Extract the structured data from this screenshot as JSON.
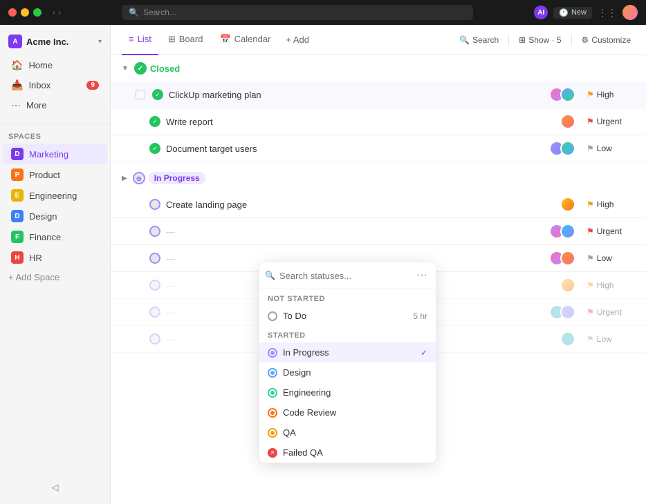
{
  "titlebar": {
    "search_placeholder": "Search...",
    "ai_label": "AI",
    "new_label": "New"
  },
  "workspace": {
    "name": "Acme Inc.",
    "icon_label": "A"
  },
  "sidebar": {
    "nav_items": [
      {
        "id": "home",
        "label": "Home",
        "icon": "🏠"
      },
      {
        "id": "inbox",
        "label": "Inbox",
        "icon": "📥",
        "badge": "9"
      },
      {
        "id": "more",
        "label": "More",
        "icon": "⋯"
      }
    ],
    "spaces_label": "Spaces",
    "spaces": [
      {
        "id": "marketing",
        "label": "Marketing",
        "color": "purple",
        "letter": "D",
        "active": true
      },
      {
        "id": "product",
        "label": "Product",
        "color": "orange",
        "letter": "P"
      },
      {
        "id": "engineering",
        "label": "Engineering",
        "color": "yellow",
        "letter": "E"
      },
      {
        "id": "design",
        "label": "Design",
        "color": "blue",
        "letter": "D"
      },
      {
        "id": "finance",
        "label": "Finance",
        "color": "green",
        "letter": "F"
      },
      {
        "id": "hr",
        "label": "HR",
        "color": "red",
        "letter": "H"
      }
    ],
    "add_space_label": "+ Add Space"
  },
  "tabs": [
    {
      "id": "list",
      "label": "List",
      "active": true
    },
    {
      "id": "board",
      "label": "Board"
    },
    {
      "id": "calendar",
      "label": "Calendar"
    },
    {
      "id": "add",
      "label": "+ Add"
    }
  ],
  "header_actions": {
    "search": "Search",
    "show": "Show · 5",
    "customize": "Customize"
  },
  "sections": {
    "closed": {
      "label": "Closed",
      "tasks": [
        {
          "name": "ClickUp marketing plan",
          "priority": "High",
          "priority_class": "high",
          "avatars": 2
        },
        {
          "name": "Write report",
          "priority": "Urgent",
          "priority_class": "urgent",
          "avatars": 1
        },
        {
          "name": "Document target users",
          "priority": "Low",
          "priority_class": "low",
          "avatars": 2
        }
      ]
    },
    "in_progress": {
      "label": "In Progress",
      "tasks": [
        {
          "name": "Create landing page",
          "priority": "High",
          "priority_class": "high",
          "avatars": 1
        },
        {
          "name": "",
          "priority": "Urgent",
          "priority_class": "urgent",
          "avatars": 2
        },
        {
          "name": "",
          "priority": "Low",
          "priority_class": "low",
          "avatars": 2
        },
        {
          "name": "",
          "priority": "High",
          "priority_class": "high",
          "avatars": 1
        },
        {
          "name": "",
          "priority": "Urgent",
          "priority_class": "urgent",
          "avatars": 2
        },
        {
          "name": "",
          "priority": "Low",
          "priority_class": "low",
          "avatars": 1
        }
      ]
    }
  },
  "dropdown": {
    "search_placeholder": "Search statuses...",
    "not_started_label": "NOT STARTED",
    "started_label": "STARTED",
    "items_not_started": [
      {
        "id": "todo",
        "label": "To Do",
        "time": "5 hr",
        "dot_class": "todo-dot"
      }
    ],
    "items_started": [
      {
        "id": "inprogress",
        "label": "In Progress",
        "dot_class": "inprogress-dot",
        "selected": true
      },
      {
        "id": "design",
        "label": "Design",
        "dot_class": "design-dot"
      },
      {
        "id": "engineering",
        "label": "Engineering",
        "dot_class": "engineering-dot"
      },
      {
        "id": "codereview",
        "label": "Code Review",
        "dot_class": "codereview-dot"
      },
      {
        "id": "qa",
        "label": "QA",
        "dot_class": "qa-dot"
      },
      {
        "id": "failedqa",
        "label": "Failed QA",
        "dot_class": "failedqa-dot"
      }
    ]
  }
}
